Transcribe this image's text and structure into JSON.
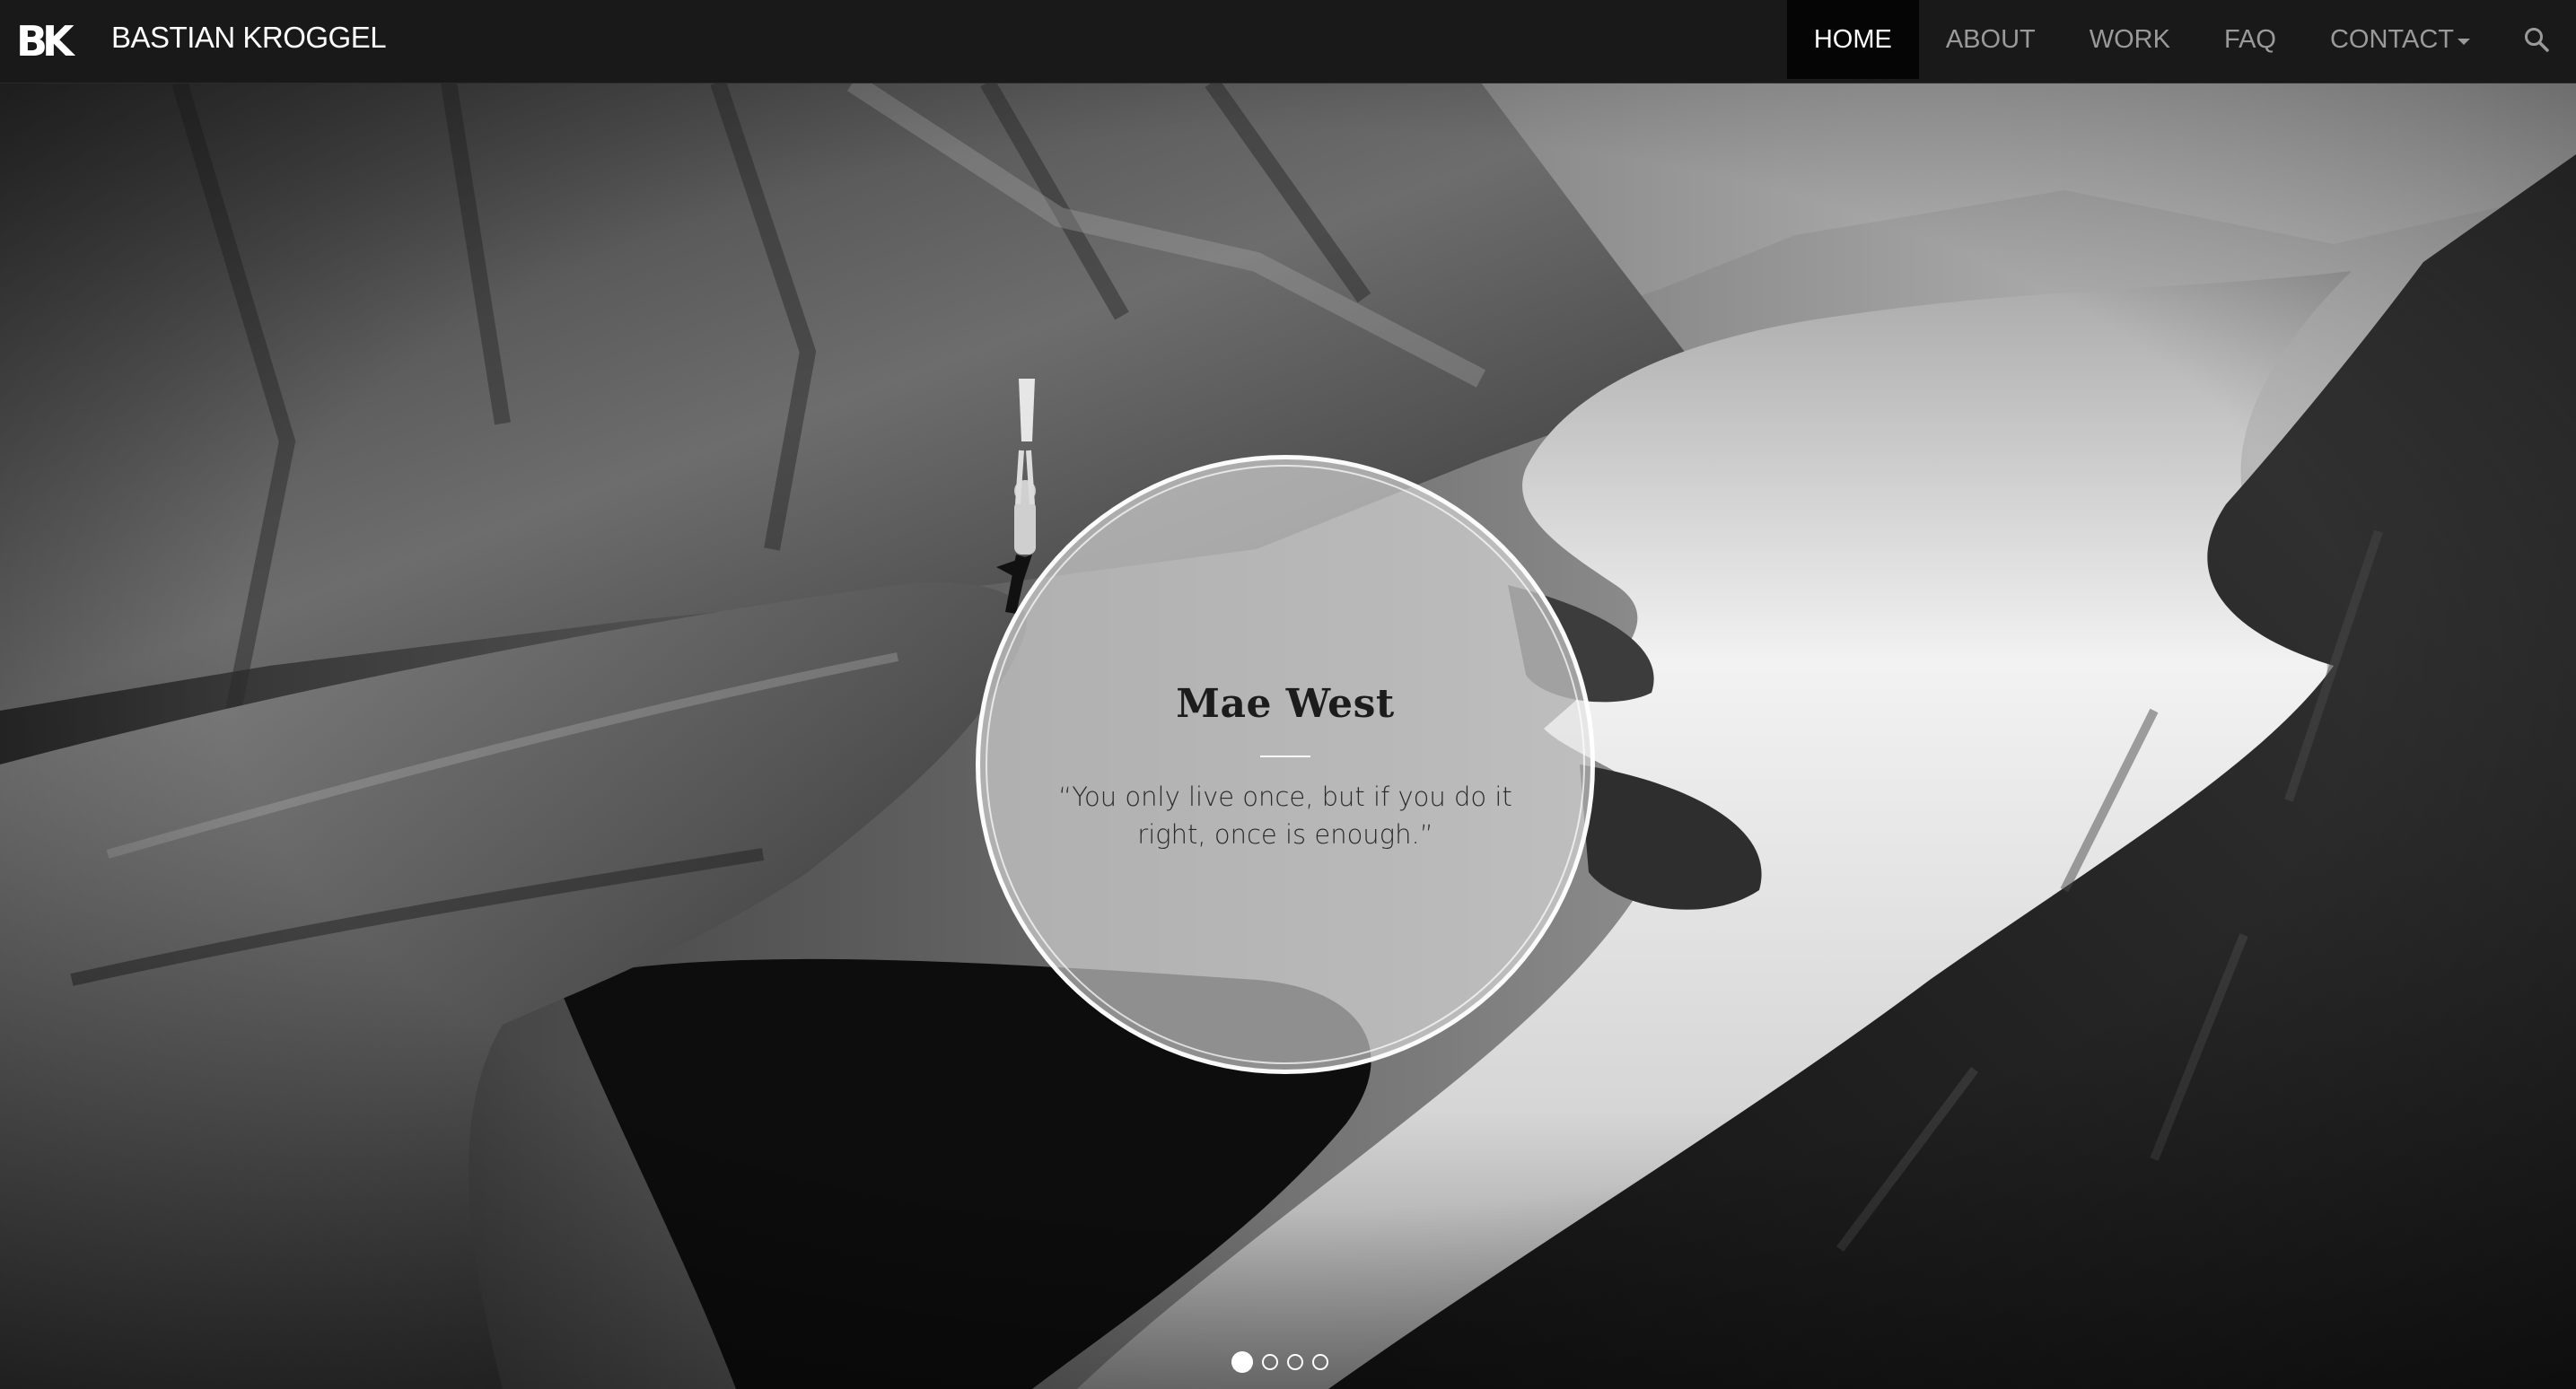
{
  "brand": {
    "logo": "BK",
    "name": "BASTIAN KROGGEL"
  },
  "nav": {
    "items": [
      {
        "label": "HOME",
        "active": true
      },
      {
        "label": "ABOUT",
        "active": false
      },
      {
        "label": "WORK",
        "active": false
      },
      {
        "label": "FAQ",
        "active": false
      },
      {
        "label": "CONTACT",
        "active": false,
        "dropdown": true
      }
    ],
    "search_icon": "search-icon"
  },
  "hero": {
    "quote_author": "Mae West",
    "quote_text": "“You only live once, but if you do it right, once is enough.”",
    "slides_total": 4,
    "active_slide": 1
  },
  "colors": {
    "navbar_bg": "#191919",
    "nav_active_bg": "#050505",
    "nav_text": "#9a9a9a",
    "nav_active_text": "#ffffff"
  }
}
